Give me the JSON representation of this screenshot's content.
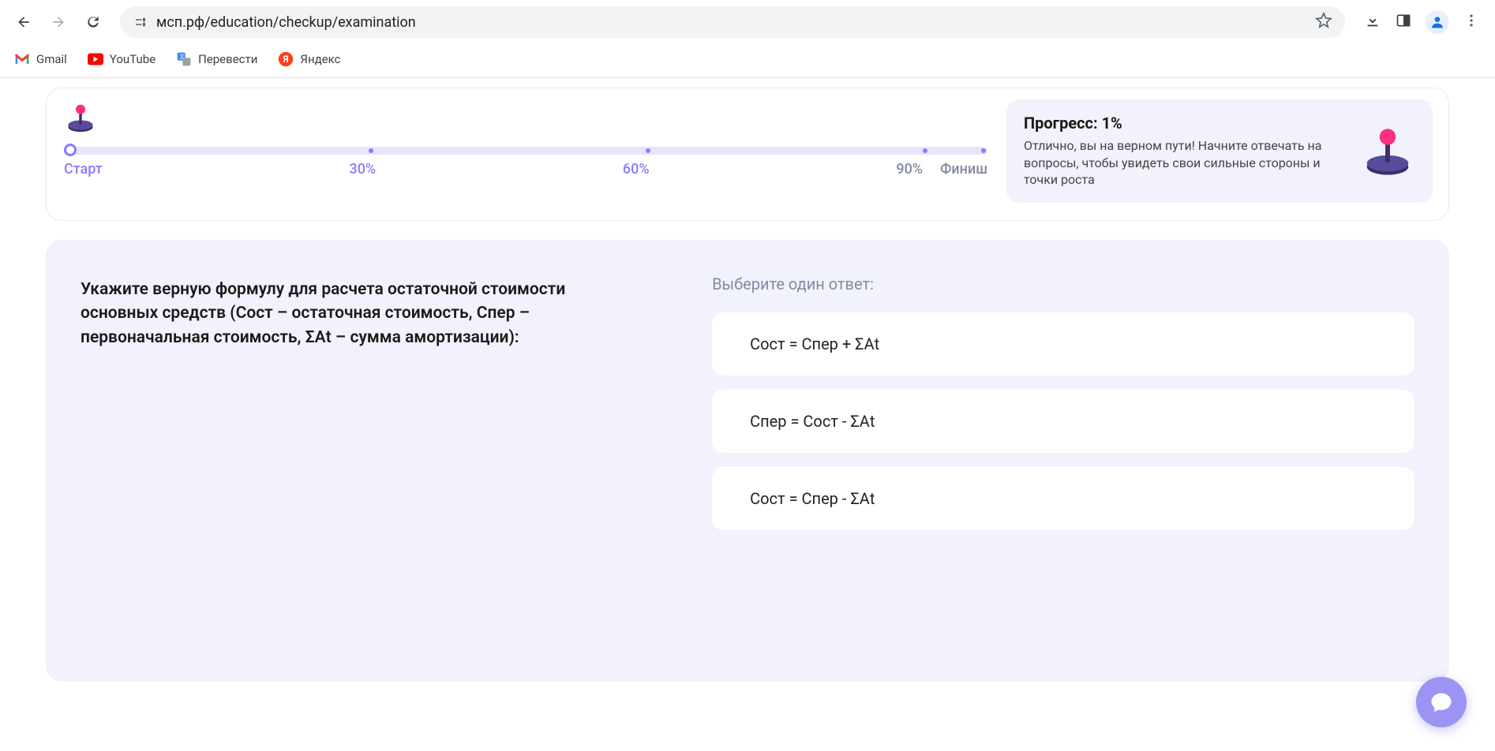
{
  "browser": {
    "url": "мсп.рф/education/checkup/examination",
    "bookmarks": [
      "Gmail",
      "YouTube",
      "Перевести",
      "Яндекс"
    ]
  },
  "progress": {
    "marks": {
      "start": "Старт",
      "p30": "30%",
      "p60": "60%",
      "p90": "90%",
      "finish": "Финиш"
    },
    "card": {
      "title": "Прогресс: 1%",
      "desc": "Отлично, вы на верном пути! Начните отвечать на вопросы, чтобы увидеть свои сильные стороны и точки роста"
    }
  },
  "exam": {
    "question": "Укажите верную формулу для расчета остаточной стоимости основных средств (Сост – остаточная стоимость, Спер – первоначальная стоимость, ΣАt – сумма амортизации):",
    "hint": "Выберите один ответ:",
    "answers": [
      "Сост = Спер + ΣАt",
      "Спер = Сост - ΣАt",
      "Сост = Спер - ΣАt"
    ]
  }
}
